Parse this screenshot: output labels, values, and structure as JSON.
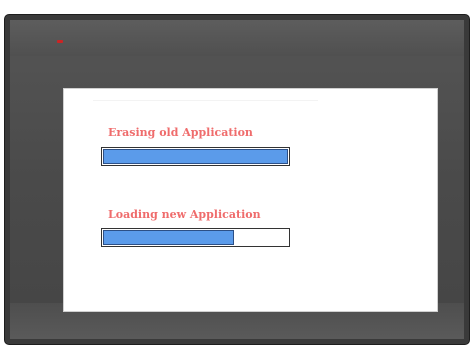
{
  "status_led_color": "#cc2424",
  "screen": {
    "erase": {
      "label": "Erasing old Application",
      "progress_fraction": 1.0,
      "bar_color": "#5b9bea"
    },
    "load": {
      "label": "Loading new Application",
      "progress_fraction": 0.71,
      "bar_color": "#5b9bea"
    },
    "label_color": "#ef6c6c"
  }
}
